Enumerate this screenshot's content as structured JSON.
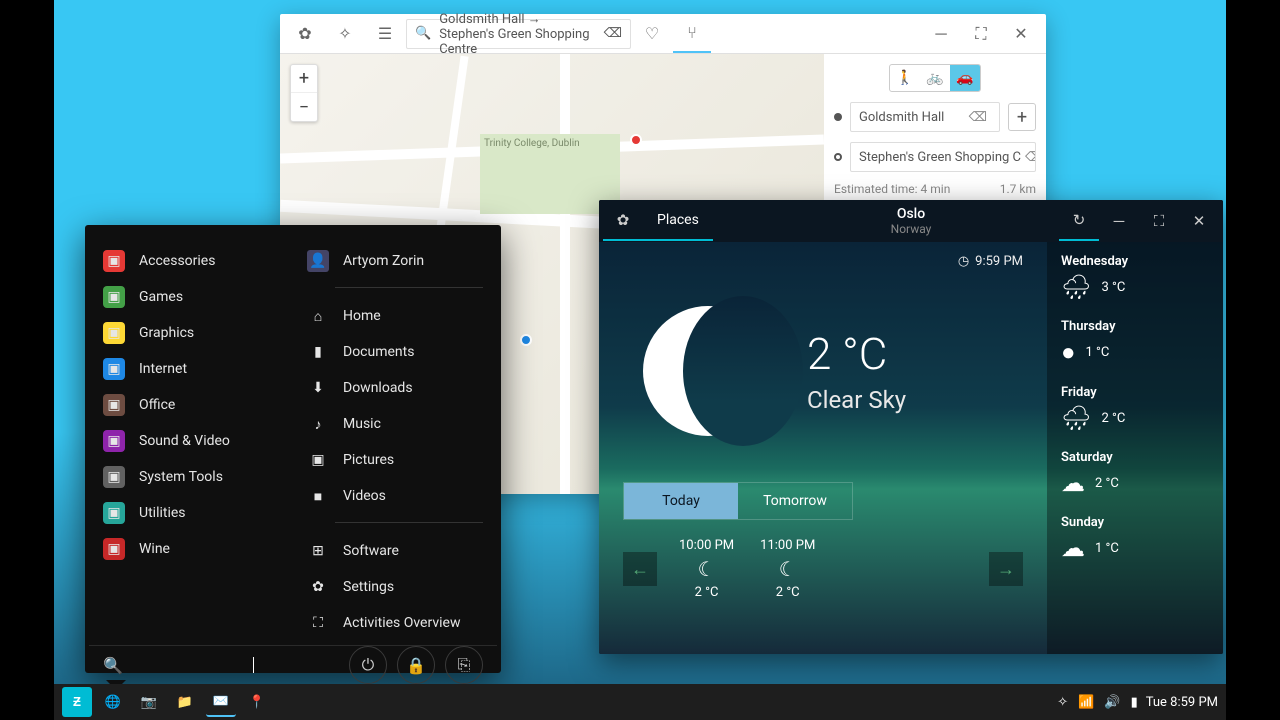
{
  "maps": {
    "search_value": "Goldsmith Hall → Stephen's Green Shopping Centre",
    "from": "Goldsmith Hall",
    "to": "Stephen's Green Shopping C",
    "est_label": "Estimated time: 4 min",
    "est_dist": "1.7 km"
  },
  "weather": {
    "places_tab": "Places",
    "city": "Oslo",
    "country": "Norway",
    "time": "9:59 PM",
    "temp": "2 °C",
    "desc": "Clear Sky",
    "today": "Today",
    "tomorrow": "Tomorrow",
    "hourly": [
      {
        "time": "10:00 PM",
        "temp": "2 °C"
      },
      {
        "time": "11:00 PM",
        "temp": "2 °C"
      }
    ],
    "forecast": [
      {
        "day": "Wednesday",
        "temp": "3 °C",
        "icon": "rain"
      },
      {
        "day": "Thursday",
        "temp": "1 °C",
        "icon": "clear"
      },
      {
        "day": "Friday",
        "temp": "2 °C",
        "icon": "rain"
      },
      {
        "day": "Saturday",
        "temp": "2 °C",
        "icon": "cloudy"
      },
      {
        "day": "Sunday",
        "temp": "1 °C",
        "icon": "cloudy"
      }
    ]
  },
  "start": {
    "user": "Artyom Zorin",
    "categories": [
      {
        "label": "Accessories",
        "color": "#e53935"
      },
      {
        "label": "Games",
        "color": "#43a047"
      },
      {
        "label": "Graphics",
        "color": "#fdd835"
      },
      {
        "label": "Internet",
        "color": "#1e88e5"
      },
      {
        "label": "Office",
        "color": "#6d4c41"
      },
      {
        "label": "Sound & Video",
        "color": "#8e24aa"
      },
      {
        "label": "System Tools",
        "color": "#616161"
      },
      {
        "label": "Utilities",
        "color": "#26a69a"
      },
      {
        "label": "Wine",
        "color": "#c62828"
      }
    ],
    "places": [
      {
        "label": "Home",
        "icon": "⌂"
      },
      {
        "label": "Documents",
        "icon": "▮"
      },
      {
        "label": "Downloads",
        "icon": "⬇"
      },
      {
        "label": "Music",
        "icon": "♪"
      },
      {
        "label": "Pictures",
        "icon": "▣"
      },
      {
        "label": "Videos",
        "icon": "■"
      }
    ],
    "system": [
      {
        "label": "Software",
        "icon": "⊞"
      },
      {
        "label": "Settings",
        "icon": "✿"
      },
      {
        "label": "Activities Overview",
        "icon": "⛶"
      }
    ]
  },
  "taskbar": {
    "clock": "Tue  8:59 PM"
  }
}
